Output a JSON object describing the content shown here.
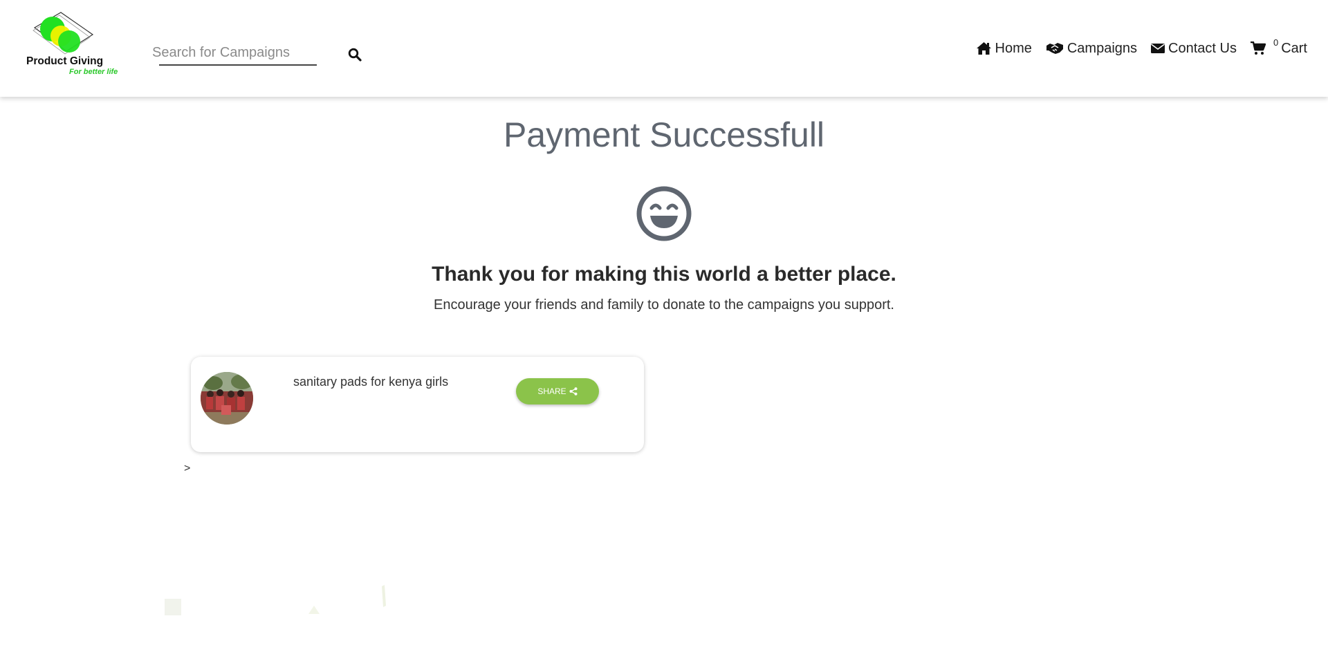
{
  "header": {
    "logo": {
      "title": "Product Giving",
      "tagline": "For better life"
    },
    "search": {
      "placeholder": "Search for Campaigns",
      "value": "",
      "button_icon": "search-icon"
    },
    "nav": [
      {
        "label": "Home",
        "icon": "home-icon"
      },
      {
        "label": "Campaigns",
        "icon": "handshake-icon"
      },
      {
        "label": "Contact Us",
        "icon": "envelope-icon"
      }
    ],
    "cart": {
      "count": "0",
      "label": "Cart",
      "icon": "cart-icon"
    }
  },
  "main": {
    "title": "Payment Successfull",
    "icon": "smiley-icon",
    "thanks": "Thank you for making this world a better place.",
    "encourage": "Encourage your friends and family to donate to the campaigns you support.",
    "stray_text": ">"
  },
  "campaigns": [
    {
      "name": "sanitary pads for kenya girls",
      "share_label": "SHARE",
      "share_icon": "share-icon"
    }
  ],
  "colors": {
    "title": "#5f6670",
    "share_button": "#8bc34a",
    "logo_green": "#2ac82a",
    "logo_yellow": "#f2f200"
  }
}
